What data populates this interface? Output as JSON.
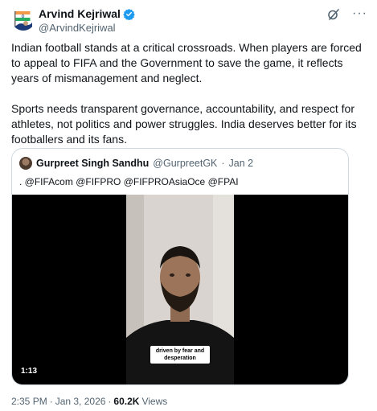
{
  "author": {
    "display_name": "Arvind Kejriwal",
    "handle": "@ArvindKejriwal",
    "verified": true
  },
  "tweet": {
    "paragraphs": [
      "Indian football stands at a critical crossroads. When players are forced to appeal to FIFA and the Government to save the game, it reflects years of mismanagement and neglect.",
      "Sports needs transparent governance, accountability, and respect for athletes, not politics and power struggles. India deserves better for its footballers and its fans."
    ]
  },
  "quote": {
    "display_name": "Gurpreet Singh Sandhu",
    "handle": "@GurpreetGK",
    "separator": "·",
    "date": "Jan 2",
    "text": ". @FIFAcom @FIFPRO @FIFPROAsiaOce @FPAI",
    "video": {
      "caption": "driven by fear and desperation",
      "duration": "1:13"
    }
  },
  "footer": {
    "time": "2:35 PM",
    "separator1": "·",
    "date": "Jan 3, 2026",
    "separator2": "·",
    "views_count": "60.2K",
    "views_label": "Views"
  },
  "colors": {
    "text": "#0f1419",
    "secondary": "#536471",
    "verified": "#1d9bf0",
    "border": "#cfd9de"
  },
  "icons": [
    "avatar-flag-icon",
    "verified-badge-icon",
    "grok-icon",
    "more-icon"
  ]
}
